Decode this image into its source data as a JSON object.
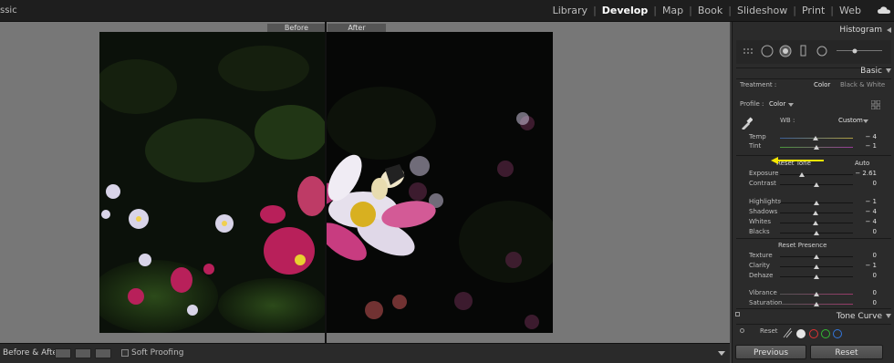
{
  "app": {
    "title": "ssic"
  },
  "modules": [
    "Library",
    "Develop",
    "Map",
    "Book",
    "Slideshow",
    "Print",
    "Web"
  ],
  "active_module": "Develop",
  "view": {
    "before_label": "Before",
    "after_label": "After"
  },
  "toolbar": {
    "before_after_label": "Before & After :",
    "soft_proofing_label": "Soft Proofing",
    "soft_proofing_checked": false
  },
  "panels": {
    "histogram_title": "Histogram",
    "basic_title": "Basic",
    "tone_curve_title": "Tone Curve"
  },
  "basic": {
    "treatment_label": "Treatment :",
    "treatment_color": "Color",
    "treatment_bw": "Black & White",
    "profile_label": "Profile :",
    "profile_value": "Color",
    "wb_label": "WB :",
    "wb_value": "Custom",
    "reset_tone_label": "Reset Tone",
    "auto_label": "Auto",
    "reset_presence_label": "Reset Presence",
    "sliders": [
      {
        "label": "Temp",
        "value": "− 4",
        "pos": 0.49
      },
      {
        "label": "Tint",
        "value": "− 1",
        "pos": 0.5
      },
      {
        "label": "Exposure",
        "value": "− 2.61",
        "pos": 0.3
      },
      {
        "label": "Contrast",
        "value": "0",
        "pos": 0.5
      },
      {
        "label": "Highlights",
        "value": "− 1",
        "pos": 0.5
      },
      {
        "label": "Shadows",
        "value": "− 4",
        "pos": 0.49
      },
      {
        "label": "Whites",
        "value": "− 4",
        "pos": 0.49
      },
      {
        "label": "Blacks",
        "value": "0",
        "pos": 0.5
      },
      {
        "label": "Texture",
        "value": "0",
        "pos": 0.5
      },
      {
        "label": "Clarity",
        "value": "− 1",
        "pos": 0.5
      },
      {
        "label": "Dehaze",
        "value": "0",
        "pos": 0.5
      },
      {
        "label": "Vibrance",
        "value": "0",
        "pos": 0.5
      },
      {
        "label": "Saturation",
        "value": "0",
        "pos": 0.5
      }
    ]
  },
  "tone_curve": {
    "reset_label": "Reset"
  },
  "footer": {
    "previous_label": "Previous",
    "reset_label": "Reset"
  },
  "colors": {
    "accent_arrow": "#f5e600",
    "panel_bg": "#2b2b2b",
    "canvas_bg": "#777777"
  }
}
